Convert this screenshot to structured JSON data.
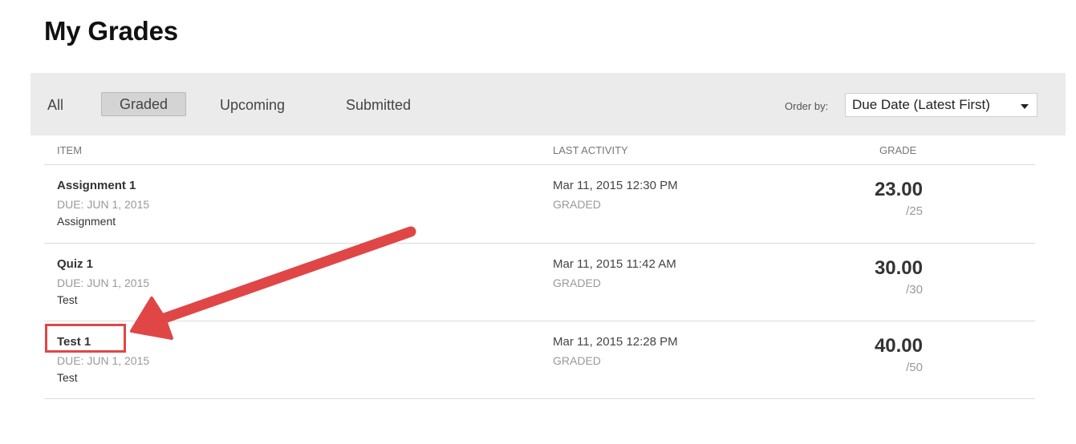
{
  "page": {
    "title": "My Grades"
  },
  "filters": {
    "tabs": [
      {
        "label": "All",
        "active": false
      },
      {
        "label": "Graded",
        "active": true
      },
      {
        "label": "Upcoming",
        "active": false
      },
      {
        "label": "Submitted",
        "active": false
      }
    ],
    "order_label": "Order by:",
    "order_value": "Due Date (Latest First)"
  },
  "columns": {
    "item": "ITEM",
    "last_activity": "LAST ACTIVITY",
    "grade": "GRADE"
  },
  "rows": [
    {
      "title": "Assignment 1",
      "due": "DUE: JUN 1, 2015",
      "type": "Assignment",
      "activity_date": "Mar 11, 2015 12:30 PM",
      "status": "GRADED",
      "score": "23.00",
      "max": "/25"
    },
    {
      "title": "Quiz 1",
      "due": "DUE: JUN 1, 2015",
      "type": "Test",
      "activity_date": "Mar 11, 2015 11:42 AM",
      "status": "GRADED",
      "score": "30.00",
      "max": "/30"
    },
    {
      "title": "Test 1",
      "due": "DUE: JUN 1, 2015",
      "type": "Test",
      "activity_date": "Mar 11, 2015 12:28 PM",
      "status": "GRADED",
      "score": "40.00",
      "max": "/50"
    }
  ],
  "annotation": {
    "color": "#e04646",
    "target": "Test 1"
  },
  "colors": {
    "filter_bar": "#ebebeb",
    "active_tab": "#d4d4d4",
    "muted_text": "#999999"
  }
}
